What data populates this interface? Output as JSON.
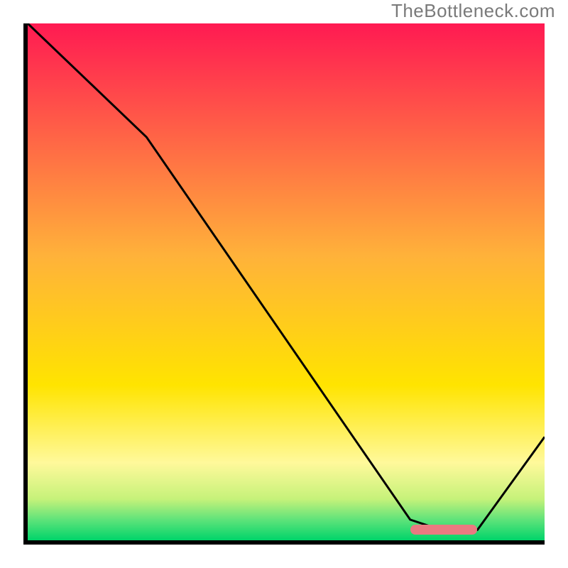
{
  "watermark": "TheBottleneck.com",
  "colors": {
    "top": "#ff1a52",
    "mid_upper": "#ff7a2e",
    "mid": "#ffe400",
    "mid_lower": "#fff99b",
    "green1": "#c6f27a",
    "green2": "#5fe37a",
    "green3": "#00d46a",
    "curve": "#000000",
    "marker": "#e97a81",
    "axis": "#000000"
  },
  "chart_data": {
    "type": "line",
    "title": "",
    "xlabel": "",
    "ylabel": "",
    "xlim": [
      0,
      100
    ],
    "ylim": [
      0,
      100
    ],
    "x": [
      0,
      23,
      74,
      80,
      87,
      100
    ],
    "bottleneck": [
      100,
      78,
      4,
      2,
      2,
      20
    ],
    "optimal_range_x": [
      74,
      87
    ],
    "optimal_y": 2,
    "gradient_stops": [
      {
        "pct": 0,
        "color": "#ff1a52"
      },
      {
        "pct": 45,
        "color": "#ffb23a"
      },
      {
        "pct": 70,
        "color": "#ffe400"
      },
      {
        "pct": 85,
        "color": "#fff99b"
      },
      {
        "pct": 92,
        "color": "#c6f27a"
      },
      {
        "pct": 96,
        "color": "#5fe37a"
      },
      {
        "pct": 100,
        "color": "#00d46a"
      }
    ]
  }
}
